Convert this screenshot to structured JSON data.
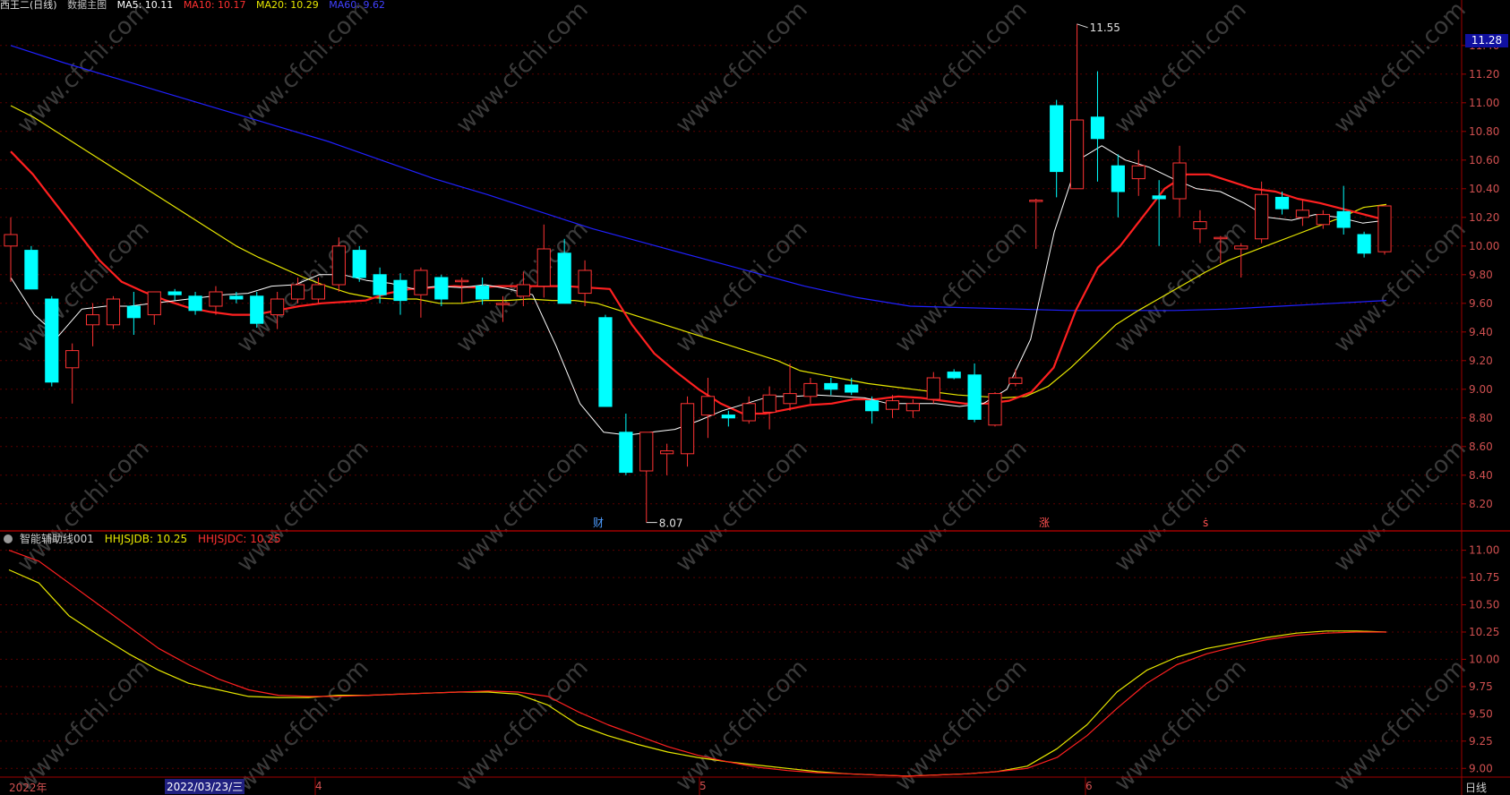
{
  "header": {
    "title": "西王⼆(日线)",
    "indicator": "数据主图",
    "ma5": "MA5: 10.11",
    "ma10": "MA10: 10.17",
    "ma20": "MA20: 10.29",
    "ma60": "MA60: 9.62"
  },
  "sub_header": {
    "name": "智能辅助线001",
    "line1": "HHJSJDB: 10.25",
    "line2": "HHJSJDC: 10.25"
  },
  "last_price": "11.28",
  "period_label": "日线",
  "x_labels": {
    "start": "2022年",
    "selected": "2022/03/23/三",
    "m4": "4",
    "m5": "5",
    "m6": "6"
  },
  "markers": {
    "cai": "财",
    "zhang": "涨",
    "s": "ṡ"
  },
  "extremes": {
    "high": "11.55",
    "low": "8.07"
  },
  "watermark": "www.cfchi.com",
  "colors": {
    "bg": "#000000",
    "up": "#ff3333",
    "down": "#00ffff",
    "ma5": "#ffffff",
    "ma10": "#ff2020",
    "ma20": "#e6e600",
    "ma60": "#2020ff",
    "axis": "#a00000",
    "grid": "#5a0000",
    "sub_yellow": "#e6e600",
    "sub_red": "#ff2020"
  },
  "chart_data": [
    {
      "type": "candlestick",
      "ylim": [
        8.0,
        11.6
      ],
      "yticks": [
        8.2,
        8.4,
        8.6,
        8.8,
        9.0,
        9.2,
        9.4,
        9.6,
        9.8,
        10.0,
        10.2,
        10.4,
        10.6,
        10.8,
        11.0,
        11.2,
        11.4
      ],
      "candles": [
        {
          "o": 10.0,
          "h": 10.2,
          "l": 9.75,
          "c": 10.08
        },
        {
          "o": 9.97,
          "h": 10.0,
          "l": 9.7,
          "c": 9.7
        },
        {
          "o": 9.63,
          "h": 9.65,
          "l": 9.02,
          "c": 9.05
        },
        {
          "o": 9.15,
          "h": 9.32,
          "l": 8.9,
          "c": 9.27
        },
        {
          "o": 9.45,
          "h": 9.6,
          "l": 9.3,
          "c": 9.52
        },
        {
          "o": 9.45,
          "h": 9.65,
          "l": 9.42,
          "c": 9.63
        },
        {
          "o": 9.58,
          "h": 9.68,
          "l": 9.38,
          "c": 9.5
        },
        {
          "o": 9.52,
          "h": 9.68,
          "l": 9.45,
          "c": 9.68
        },
        {
          "o": 9.68,
          "h": 9.7,
          "l": 9.62,
          "c": 9.66
        },
        {
          "o": 9.65,
          "h": 9.68,
          "l": 9.52,
          "c": 9.55
        },
        {
          "o": 9.58,
          "h": 9.72,
          "l": 9.52,
          "c": 9.68
        },
        {
          "o": 9.65,
          "h": 9.68,
          "l": 9.6,
          "c": 9.63
        },
        {
          "o": 9.65,
          "h": 9.68,
          "l": 9.43,
          "c": 9.46
        },
        {
          "o": 9.52,
          "h": 9.68,
          "l": 9.42,
          "c": 9.63
        },
        {
          "o": 9.63,
          "h": 9.78,
          "l": 9.6,
          "c": 9.73
        },
        {
          "o": 9.63,
          "h": 9.78,
          "l": 9.6,
          "c": 9.73
        },
        {
          "o": 9.73,
          "h": 10.06,
          "l": 9.68,
          "c": 10.0
        },
        {
          "o": 9.97,
          "h": 10.0,
          "l": 9.75,
          "c": 9.78
        },
        {
          "o": 9.8,
          "h": 9.85,
          "l": 9.6,
          "c": 9.66
        },
        {
          "o": 9.76,
          "h": 9.81,
          "l": 9.52,
          "c": 9.62
        },
        {
          "o": 9.66,
          "h": 9.85,
          "l": 9.5,
          "c": 9.83
        },
        {
          "o": 9.78,
          "h": 9.8,
          "l": 9.58,
          "c": 9.63
        },
        {
          "o": 9.76,
          "h": 9.78,
          "l": 9.6,
          "c": 9.76
        },
        {
          "o": 9.72,
          "h": 9.78,
          "l": 9.59,
          "c": 9.63
        },
        {
          "o": 9.6,
          "h": 9.65,
          "l": 9.47,
          "c": 9.6
        },
        {
          "o": 9.65,
          "h": 9.82,
          "l": 9.58,
          "c": 9.73
        },
        {
          "o": 9.72,
          "h": 10.15,
          "l": 9.64,
          "c": 9.98
        },
        {
          "o": 9.95,
          "h": 10.05,
          "l": 9.65,
          "c": 9.6
        },
        {
          "o": 9.67,
          "h": 9.9,
          "l": 9.58,
          "c": 9.83
        },
        {
          "o": 9.5,
          "h": 9.52,
          "l": 8.88,
          "c": 8.88
        },
        {
          "o": 8.7,
          "h": 8.83,
          "l": 8.4,
          "c": 8.42
        },
        {
          "o": 8.43,
          "h": 8.7,
          "l": 8.07,
          "c": 8.7
        },
        {
          "o": 8.55,
          "h": 8.62,
          "l": 8.4,
          "c": 8.57
        },
        {
          "o": 8.55,
          "h": 8.95,
          "l": 8.46,
          "c": 8.9
        },
        {
          "o": 8.82,
          "h": 9.08,
          "l": 8.66,
          "c": 8.95
        },
        {
          "o": 8.82,
          "h": 8.85,
          "l": 8.74,
          "c": 8.8
        },
        {
          "o": 8.78,
          "h": 8.95,
          "l": 8.76,
          "c": 8.9
        },
        {
          "o": 8.84,
          "h": 9.02,
          "l": 8.72,
          "c": 8.96
        },
        {
          "o": 8.9,
          "h": 9.18,
          "l": 8.85,
          "c": 8.97
        },
        {
          "o": 8.95,
          "h": 9.08,
          "l": 8.9,
          "c": 9.04
        },
        {
          "o": 9.04,
          "h": 9.08,
          "l": 8.96,
          "c": 9.0
        },
        {
          "o": 9.03,
          "h": 9.08,
          "l": 8.96,
          "c": 8.98
        },
        {
          "o": 8.92,
          "h": 8.95,
          "l": 8.76,
          "c": 8.85
        },
        {
          "o": 8.86,
          "h": 8.96,
          "l": 8.8,
          "c": 8.92
        },
        {
          "o": 8.85,
          "h": 8.93,
          "l": 8.8,
          "c": 8.9
        },
        {
          "o": 8.93,
          "h": 9.12,
          "l": 8.9,
          "c": 9.08
        },
        {
          "o": 9.12,
          "h": 9.14,
          "l": 9.07,
          "c": 9.08
        },
        {
          "o": 9.1,
          "h": 9.18,
          "l": 8.77,
          "c": 8.79
        },
        {
          "o": 8.75,
          "h": 8.98,
          "l": 8.74,
          "c": 8.97
        },
        {
          "o": 9.04,
          "h": 9.14,
          "l": 9.02,
          "c": 9.08
        },
        {
          "o": 10.32,
          "h": 10.33,
          "l": 9.98,
          "c": 10.32
        },
        {
          "o": 10.98,
          "h": 11.02,
          "l": 10.34,
          "c": 10.52
        },
        {
          "o": 10.4,
          "h": 11.55,
          "l": 10.4,
          "c": 10.88
        },
        {
          "o": 10.9,
          "h": 11.22,
          "l": 10.45,
          "c": 10.75
        },
        {
          "o": 10.56,
          "h": 10.64,
          "l": 10.2,
          "c": 10.38
        },
        {
          "o": 10.47,
          "h": 10.67,
          "l": 10.35,
          "c": 10.56
        },
        {
          "o": 10.35,
          "h": 10.46,
          "l": 10.0,
          "c": 10.33
        },
        {
          "o": 10.33,
          "h": 10.7,
          "l": 10.2,
          "c": 10.58
        },
        {
          "o": 10.12,
          "h": 10.25,
          "l": 10.02,
          "c": 10.17
        },
        {
          "o": 10.06,
          "h": 10.07,
          "l": 9.88,
          "c": 10.06
        },
        {
          "o": 9.98,
          "h": 10.02,
          "l": 9.78,
          "c": 10.0
        },
        {
          "o": 10.05,
          "h": 10.45,
          "l": 10.02,
          "c": 10.36
        },
        {
          "o": 10.34,
          "h": 10.38,
          "l": 10.22,
          "c": 10.26
        },
        {
          "o": 10.2,
          "h": 10.32,
          "l": 10.14,
          "c": 10.25
        },
        {
          "o": 10.15,
          "h": 10.25,
          "l": 10.12,
          "c": 10.22
        },
        {
          "o": 10.24,
          "h": 10.42,
          "l": 10.08,
          "c": 10.13
        },
        {
          "o": 10.08,
          "h": 10.1,
          "l": 9.92,
          "c": 9.95
        },
        {
          "o": 9.96,
          "h": 10.28,
          "l": 9.94,
          "c": 10.28
        }
      ],
      "ma5": [
        9.78,
        9.52,
        9.37,
        9.56,
        9.58,
        9.58,
        9.6,
        9.62,
        9.64,
        9.66,
        9.67,
        9.72,
        9.73,
        9.8,
        9.8,
        9.76,
        9.74,
        9.7,
        9.72,
        9.71,
        9.73,
        9.7,
        9.66,
        9.3,
        8.9,
        8.7,
        8.68,
        8.7,
        8.72,
        8.78,
        8.85,
        8.9,
        8.95,
        8.95,
        8.96,
        8.95,
        8.94,
        8.9,
        8.9,
        8.9,
        8.88,
        8.9,
        9.0,
        9.35,
        10.1,
        10.6,
        10.7,
        10.6,
        10.55,
        10.47,
        10.4,
        10.38,
        10.3,
        10.2,
        10.18,
        10.22,
        10.2,
        10.16,
        10.18
      ],
      "ma10": [
        10.66,
        10.5,
        10.3,
        10.1,
        9.9,
        9.75,
        9.68,
        9.62,
        9.57,
        9.54,
        9.52,
        9.52,
        9.55,
        9.58,
        9.6,
        9.61,
        9.62,
        9.67,
        9.7,
        9.71,
        9.72,
        9.71,
        9.72,
        9.72,
        9.72,
        9.72,
        9.71,
        9.7,
        9.45,
        9.25,
        9.12,
        9.0,
        8.9,
        8.83,
        8.83,
        8.86,
        8.89,
        8.9,
        8.93,
        8.93,
        8.95,
        8.94,
        8.92,
        8.9,
        8.9,
        8.92,
        8.98,
        9.15,
        9.55,
        9.85,
        10.0,
        10.2,
        10.4,
        10.5,
        10.5,
        10.45,
        10.4,
        10.38,
        10.33,
        10.3,
        10.26,
        10.22,
        10.18
      ],
      "ma20": [
        10.98,
        10.9,
        10.8,
        10.7,
        10.6,
        10.5,
        10.4,
        10.3,
        10.2,
        10.1,
        10.0,
        9.92,
        9.85,
        9.78,
        9.72,
        9.67,
        9.64,
        9.63,
        9.63,
        9.6,
        9.6,
        9.62,
        9.62,
        9.63,
        9.62,
        9.62,
        9.6,
        9.55,
        9.5,
        9.45,
        9.4,
        9.35,
        9.3,
        9.25,
        9.2,
        9.13,
        9.1,
        9.07,
        9.04,
        9.02,
        9.0,
        8.98,
        8.96,
        8.95,
        8.94,
        8.95,
        9.02,
        9.15,
        9.3,
        9.45,
        9.55,
        9.64,
        9.73,
        9.82,
        9.9,
        9.96,
        10.02,
        10.08,
        10.14,
        10.2,
        10.27,
        10.29
      ],
      "ma60": [
        11.4,
        11.28,
        11.17,
        11.06,
        10.95,
        10.84,
        10.73,
        10.6,
        10.47,
        10.36,
        10.24,
        10.12,
        10.02,
        9.92,
        9.82,
        9.72,
        9.64,
        9.58,
        9.57,
        9.56,
        9.55,
        9.55,
        9.55,
        9.56,
        9.58,
        9.6,
        9.62
      ]
    },
    {
      "type": "line",
      "ylim": [
        8.9,
        11.15
      ],
      "yticks": [
        9.0,
        9.25,
        9.5,
        9.75,
        10.0,
        10.25,
        10.5,
        10.75,
        11.0
      ],
      "series": [
        {
          "name": "HHJSJDB",
          "color": "#e6e600",
          "values": [
            10.82,
            10.7,
            10.4,
            10.22,
            10.05,
            9.9,
            9.78,
            9.72,
            9.66,
            9.65,
            9.65,
            9.67,
            9.67,
            9.68,
            9.69,
            9.7,
            9.7,
            9.68,
            9.58,
            9.4,
            9.3,
            9.22,
            9.15,
            9.1,
            9.06,
            9.03,
            9.0,
            8.97,
            8.95,
            8.94,
            8.93,
            8.94,
            8.95,
            8.97,
            9.02,
            9.18,
            9.4,
            9.7,
            9.9,
            10.02,
            10.1,
            10.15,
            10.2,
            10.24,
            10.26,
            10.26,
            10.25
          ]
        },
        {
          "name": "HHJSJDC",
          "color": "#ff2020",
          "values": [
            11.0,
            10.9,
            10.7,
            10.5,
            10.3,
            10.1,
            9.95,
            9.82,
            9.72,
            9.67,
            9.66,
            9.66,
            9.67,
            9.68,
            9.69,
            9.7,
            9.71,
            9.7,
            9.66,
            9.52,
            9.4,
            9.3,
            9.2,
            9.12,
            9.06,
            9.01,
            8.98,
            8.96,
            8.95,
            8.94,
            8.93,
            8.94,
            8.95,
            8.97,
            9.0,
            9.1,
            9.3,
            9.55,
            9.78,
            9.95,
            10.05,
            10.12,
            10.18,
            10.22,
            10.24,
            10.25,
            10.25
          ]
        }
      ]
    }
  ]
}
